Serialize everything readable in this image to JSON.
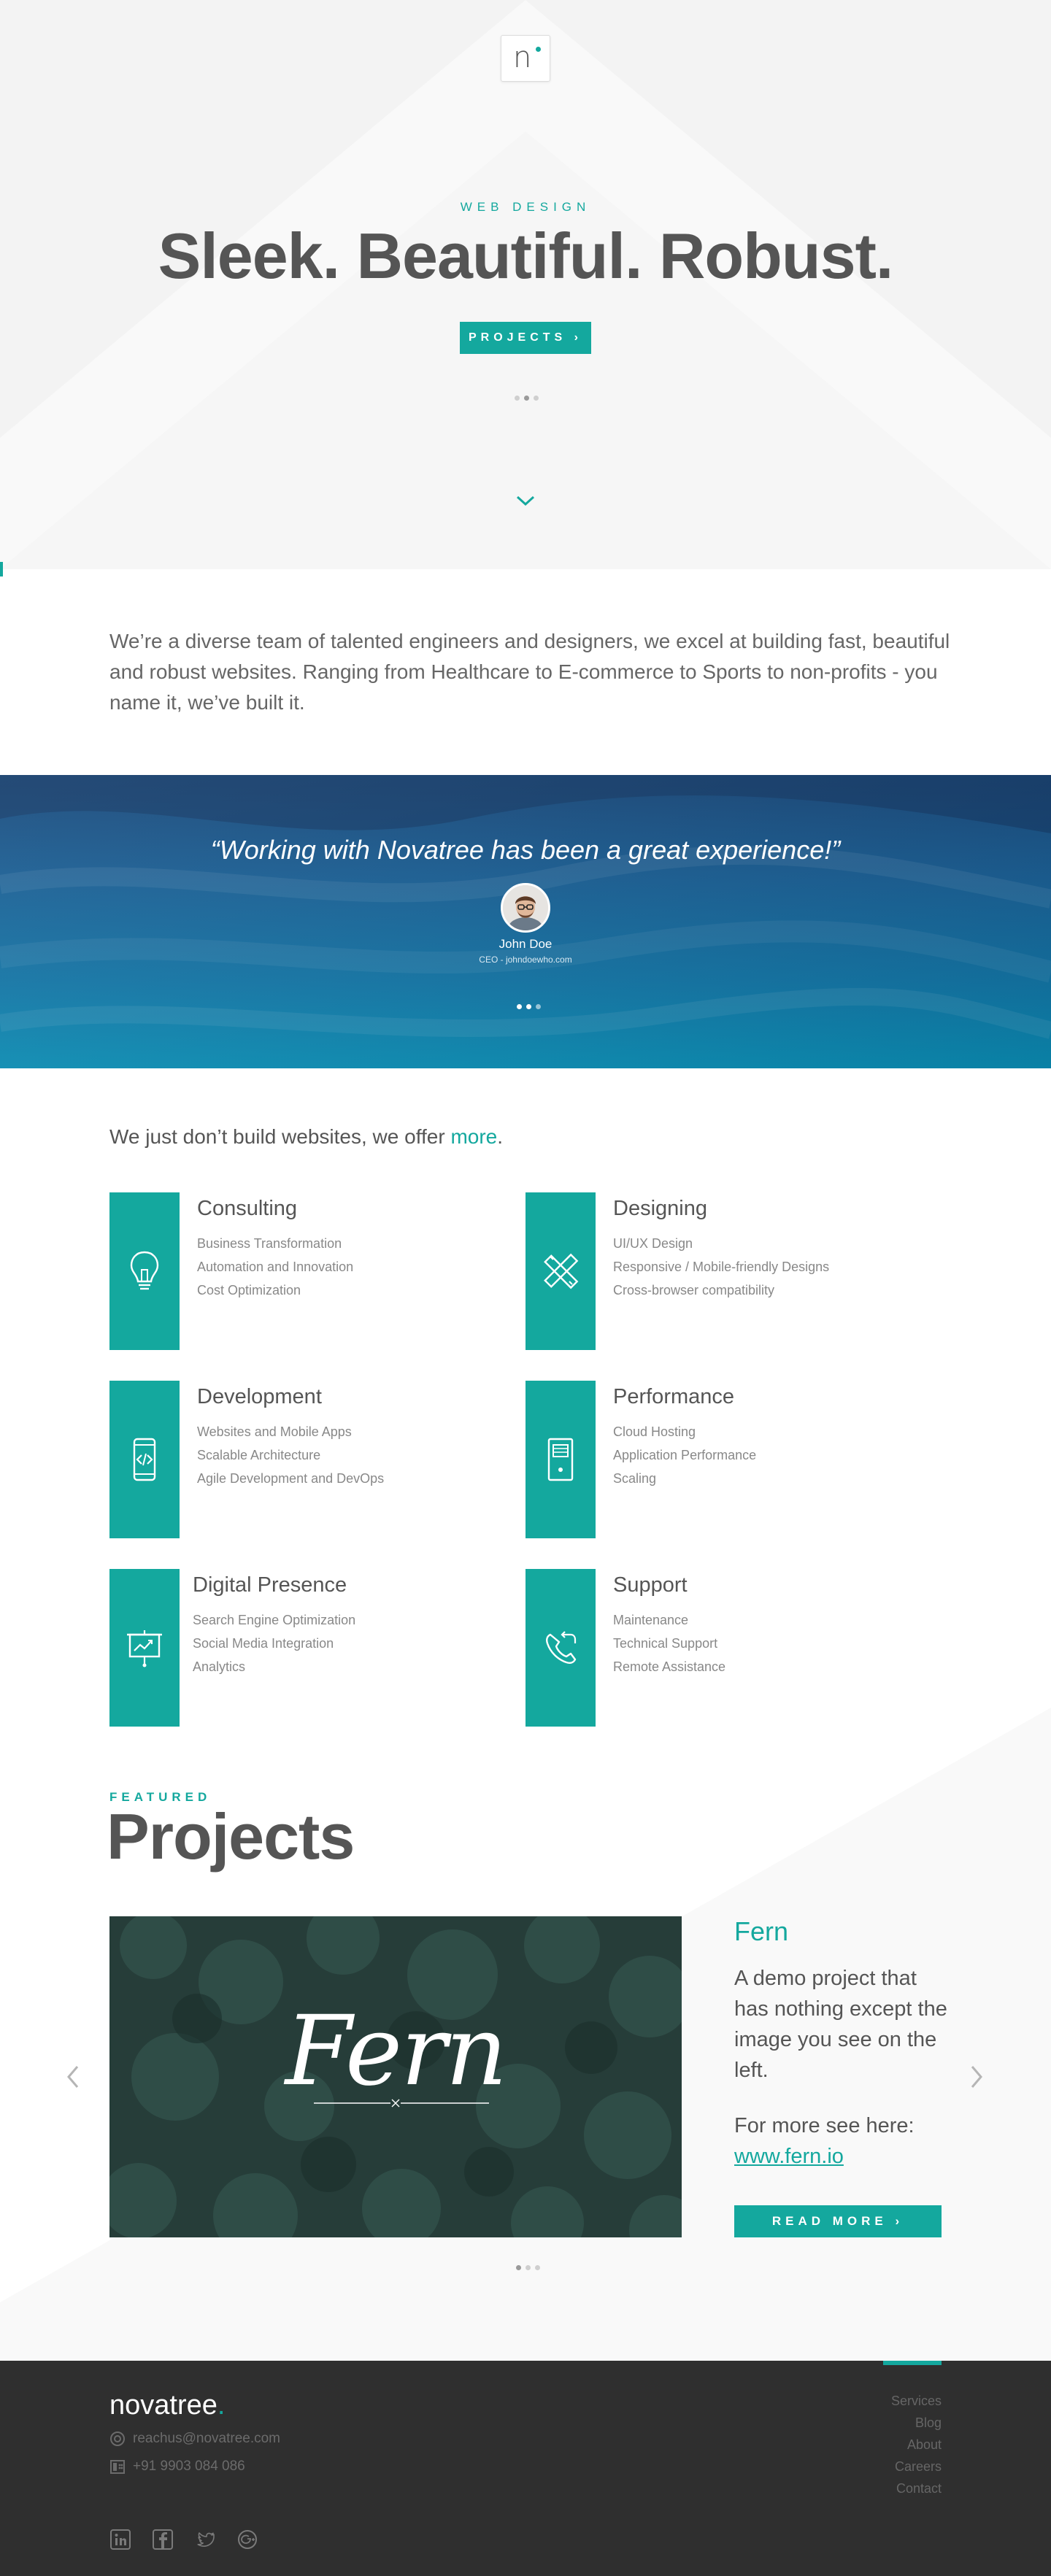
{
  "hero": {
    "logo_letter": "n",
    "eyebrow": "WEB DESIGN",
    "title": "Sleek. Beautiful. Robust.",
    "button_label": "PROJECTS ›"
  },
  "intro": {
    "text": "We’re a diverse team of talented engineers and designers, we excel at building fast, beautiful and robust websites. Ranging from Healthcare to E-commerce to Sports to non-profits - you name it, we’ve built it."
  },
  "testimonial": {
    "quote": "“Working with Novatree has been a great experience!”",
    "name": "John Doe",
    "role": "CEO - johndoewho.com"
  },
  "services": {
    "intro_prefix": "We just don’t build websites, we offer ",
    "intro_link": "more",
    "intro_suffix": ".",
    "items": [
      {
        "name": "Consulting",
        "icon": "lightbulb-icon",
        "lines": [
          "Business Transformation",
          "Automation and Innovation",
          "Cost Optimization"
        ]
      },
      {
        "name": "Designing",
        "icon": "pencil-ruler-icon",
        "lines": [
          "UI/UX Design",
          "Responsive / Mobile-friendly Designs",
          "Cross-browser compatibility"
        ]
      },
      {
        "name": "Development",
        "icon": "mobile-code-icon",
        "lines": [
          "Websites and Mobile Apps",
          "Scalable Architecture",
          "Agile Development and DevOps"
        ]
      },
      {
        "name": "Performance",
        "icon": "server-icon",
        "lines": [
          "Cloud Hosting",
          "Application Performance",
          "Scaling"
        ]
      },
      {
        "name": "Digital Presence",
        "icon": "presentation-chart-icon",
        "lines": [
          "Search Engine Optimization",
          "Social Media Integration",
          "Analytics"
        ]
      },
      {
        "name": "Support",
        "icon": "phone-callback-icon",
        "lines": [
          "Maintenance",
          "Technical Support",
          "Remote Assistance"
        ]
      }
    ]
  },
  "projects": {
    "eyebrow": "FEATURED",
    "title": "Projects",
    "image_word": "Fern",
    "name": "Fern",
    "description": "A demo project that has nothing except the image you see on the left.",
    "more_text": "For more see here:",
    "link": "www.fern.io",
    "button_label": "READ MORE ›"
  },
  "footer": {
    "brand": "novatree",
    "brand_dot": ".",
    "email": "reachus@novatree.com",
    "phone": "+91 9903 084 086",
    "links": [
      "Services",
      "Blog",
      "About",
      "Careers",
      "Contact"
    ],
    "social": [
      "linkedin-icon",
      "facebook-icon",
      "twitter-icon",
      "google-plus-icon"
    ]
  },
  "colors": {
    "accent": "#14a89e",
    "text": "#555555",
    "footer_bg": "#2f2f2f",
    "hero_bg": "#f9f9f9"
  }
}
